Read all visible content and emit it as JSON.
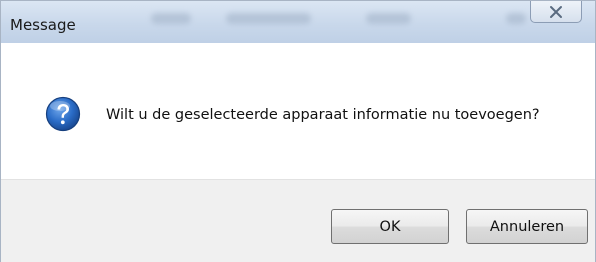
{
  "window": {
    "title": "Message"
  },
  "dialog": {
    "icon": "question-icon",
    "message": "Wilt u de geselecteerde apparaat informatie nu toevoegen?"
  },
  "buttons": {
    "ok_label": "OK",
    "cancel_label": "Annuleren"
  },
  "colors": {
    "titlebar": "#c9d8eb",
    "footer": "#f0f0f0",
    "icon_blue": "#1f5fb8"
  }
}
